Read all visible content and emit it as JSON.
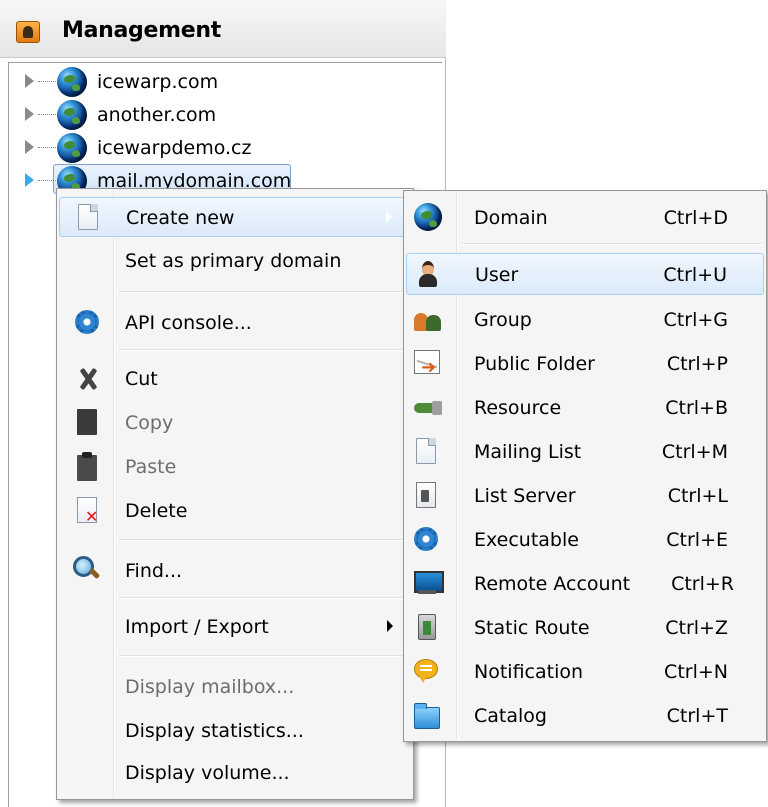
{
  "panel": {
    "title": "Management"
  },
  "tree": {
    "items": [
      {
        "label": "icewarp.com"
      },
      {
        "label": "another.com"
      },
      {
        "label": "icewarpdemo.cz"
      },
      {
        "label": "mail.mydomain.com",
        "selected": true
      }
    ]
  },
  "context_menu": {
    "items": [
      {
        "label": "Create new",
        "icon": "document-icon",
        "submenu": true
      },
      {
        "label": "Set as primary domain"
      },
      {
        "label": "API console...",
        "icon": "gear-icon"
      },
      {
        "label": "Cut",
        "icon": "scissors-icon"
      },
      {
        "label": "Copy",
        "icon": "copy-icon",
        "disabled": true
      },
      {
        "label": "Paste",
        "icon": "paste-icon",
        "disabled": true
      },
      {
        "label": "Delete",
        "icon": "delete-icon"
      },
      {
        "label": "Find...",
        "icon": "magnifier-icon"
      },
      {
        "label": "Import / Export",
        "submenu": true
      },
      {
        "label": "Display mailbox...",
        "disabled": true
      },
      {
        "label": "Display statistics..."
      },
      {
        "label": "Display volume..."
      }
    ]
  },
  "create_new_submenu": {
    "items": [
      {
        "label": "Domain",
        "shortcut": "Ctrl+D",
        "icon": "globe-icon"
      },
      {
        "label": "User",
        "shortcut": "Ctrl+U",
        "icon": "user-icon"
      },
      {
        "label": "Group",
        "shortcut": "Ctrl+G",
        "icon": "group-icon"
      },
      {
        "label": "Public Folder",
        "shortcut": "Ctrl+P",
        "icon": "public-folder-icon"
      },
      {
        "label": "Resource",
        "shortcut": "Ctrl+B",
        "icon": "resource-icon"
      },
      {
        "label": "Mailing List",
        "shortcut": "Ctrl+M",
        "icon": "document-icon"
      },
      {
        "label": "List Server",
        "shortcut": "Ctrl+L",
        "icon": "list-server-icon"
      },
      {
        "label": "Executable",
        "shortcut": "Ctrl+E",
        "icon": "gear-icon"
      },
      {
        "label": "Remote Account",
        "shortcut": "Ctrl+R",
        "icon": "monitor-icon"
      },
      {
        "label": "Static Route",
        "shortcut": "Ctrl+Z",
        "icon": "static-route-icon"
      },
      {
        "label": "Notification",
        "shortcut": "Ctrl+N",
        "icon": "notification-icon"
      },
      {
        "label": "Catalog",
        "shortcut": "Ctrl+T",
        "icon": "folder-icon"
      }
    ]
  },
  "colors": {
    "highlight_border": "#a8d0f5",
    "highlight_fill": "#dbeaf9",
    "expander_active": "#3ea9e8"
  }
}
